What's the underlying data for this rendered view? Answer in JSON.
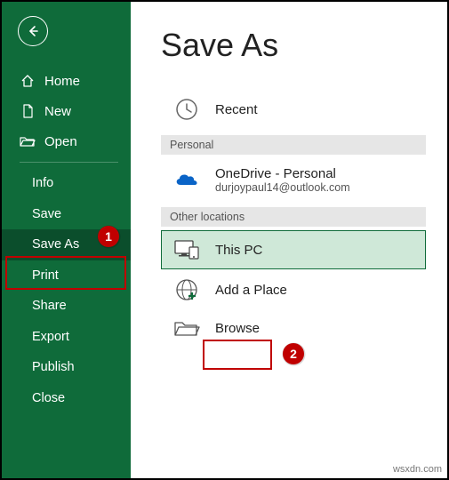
{
  "title": "Save As",
  "sidebar": {
    "home": "Home",
    "new": "New",
    "open": "Open",
    "info": "Info",
    "save": "Save",
    "save_as": "Save As",
    "print": "Print",
    "share": "Share",
    "export": "Export",
    "publish": "Publish",
    "close": "Close"
  },
  "sections": {
    "personal": "Personal",
    "other": "Other locations"
  },
  "locations": {
    "recent": "Recent",
    "onedrive_title": "OneDrive - Personal",
    "onedrive_sub": "durjoypaul14@outlook.com",
    "thispc": "This PC",
    "addplace": "Add a Place",
    "browse": "Browse"
  },
  "callouts": {
    "c1": "1",
    "c2": "2"
  },
  "watermark": "wsxdn.com"
}
